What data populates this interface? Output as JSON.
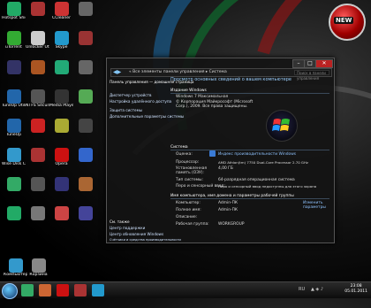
{
  "desktop": {
    "icons": [
      {
        "label": "Hotspot Shield",
        "color": "#2a6"
      },
      {
        "label": "",
        "color": "#a33"
      },
      {
        "label": "CCleaner",
        "color": "#c33"
      },
      {
        "label": "",
        "color": "#666"
      },
      {
        "label": "uTorrent",
        "color": "#3a3"
      },
      {
        "label": "Unlocker Utility",
        "color": "#ccc"
      },
      {
        "label": "Skype",
        "color": "#29c"
      },
      {
        "label": "",
        "color": "#933"
      },
      {
        "label": "",
        "color": "#336"
      },
      {
        "label": "",
        "color": "#a52"
      },
      {
        "label": "",
        "color": "#2a7"
      },
      {
        "label": "",
        "color": "#666"
      },
      {
        "label": "TuneUp Utilities",
        "color": "#26a"
      },
      {
        "label": "NTFS Security",
        "color": "#555"
      },
      {
        "label": "Media Player Classic",
        "color": "#333"
      },
      {
        "label": "",
        "color": "#5a5"
      },
      {
        "label": "TuneUp",
        "color": "#26a"
      },
      {
        "label": "",
        "color": "#c22"
      },
      {
        "label": "",
        "color": "#aa3"
      },
      {
        "label": "",
        "color": "#444"
      },
      {
        "label": "Wise Disk Cleaner",
        "color": "#39c"
      },
      {
        "label": "",
        "color": "#a33"
      },
      {
        "label": "Opera",
        "color": "#c11"
      },
      {
        "label": "",
        "color": "#36c"
      },
      {
        "label": "",
        "color": "#3a6"
      },
      {
        "label": "",
        "color": "#555"
      },
      {
        "label": "",
        "color": "#337"
      },
      {
        "label": "",
        "color": "#a63"
      },
      {
        "label": "",
        "color": "#2a6"
      },
      {
        "label": "",
        "color": "#777"
      },
      {
        "label": "",
        "color": "#c44"
      },
      {
        "label": "",
        "color": "#449"
      }
    ],
    "bottom_icons": [
      {
        "label": "Компьютер",
        "color": "#39c"
      },
      {
        "label": "Корзина",
        "color": "#888"
      }
    ],
    "badge_text": "NEW"
  },
  "window": {
    "address_path": "« Все элементы панели управления  ▸  Система",
    "search_placeholder": "Поиск в панели управления",
    "left_links": [
      "Панель управления — домашняя страница",
      "Диспетчер устройств",
      "Настройка удалённого доступа",
      "Защита системы",
      "Дополнительные параметры системы"
    ],
    "see_also": "См. также",
    "see_also_links": [
      "Центр поддержки",
      "Центр обновления Windows",
      "Счётчики и средства производительности"
    ],
    "title": "Просмотр основных сведений о вашем компьютере",
    "edition_header": "Издание Windows",
    "edition": "Windows 7 Максимальная",
    "copyright": "© Корпорация Майкрософт (Microsoft Corp.), 2009. Все права защищены.",
    "system_header": "Система",
    "rows": [
      {
        "k": "Оценка:",
        "v": "Индекс производительности Windows"
      },
      {
        "k": "Процессор:",
        "v": "AMD Athlon(tm) 7750 Dual-Core Processor 2.70 GHz"
      },
      {
        "k": "Установленная память (ОЗУ):",
        "v": "4,00 ГБ"
      },
      {
        "k": "Тип системы:",
        "v": "64-разрядная операционная система"
      },
      {
        "k": "Перо и сенсорный ввод:",
        "v": "Перо и сенсорный ввод недоступны для этого экрана"
      }
    ],
    "rating_value": "",
    "name_header": "Имя компьютера, имя домена и параметры рабочей группы",
    "name_rows": [
      {
        "k": "Компьютер:",
        "v": "Admin-ПК"
      },
      {
        "k": "Полное имя:",
        "v": "Admin-ПК"
      },
      {
        "k": "Описание:",
        "v": ""
      },
      {
        "k": "Рабочая группа:",
        "v": "WORKGROUP"
      }
    ],
    "change_settings": "Изменить параметры"
  },
  "taskbar": {
    "tray_text": "RU",
    "time": "23:08",
    "date": "05.01.2011"
  },
  "colors": {
    "accent": "#8fc3ff",
    "close": "#b22222"
  }
}
